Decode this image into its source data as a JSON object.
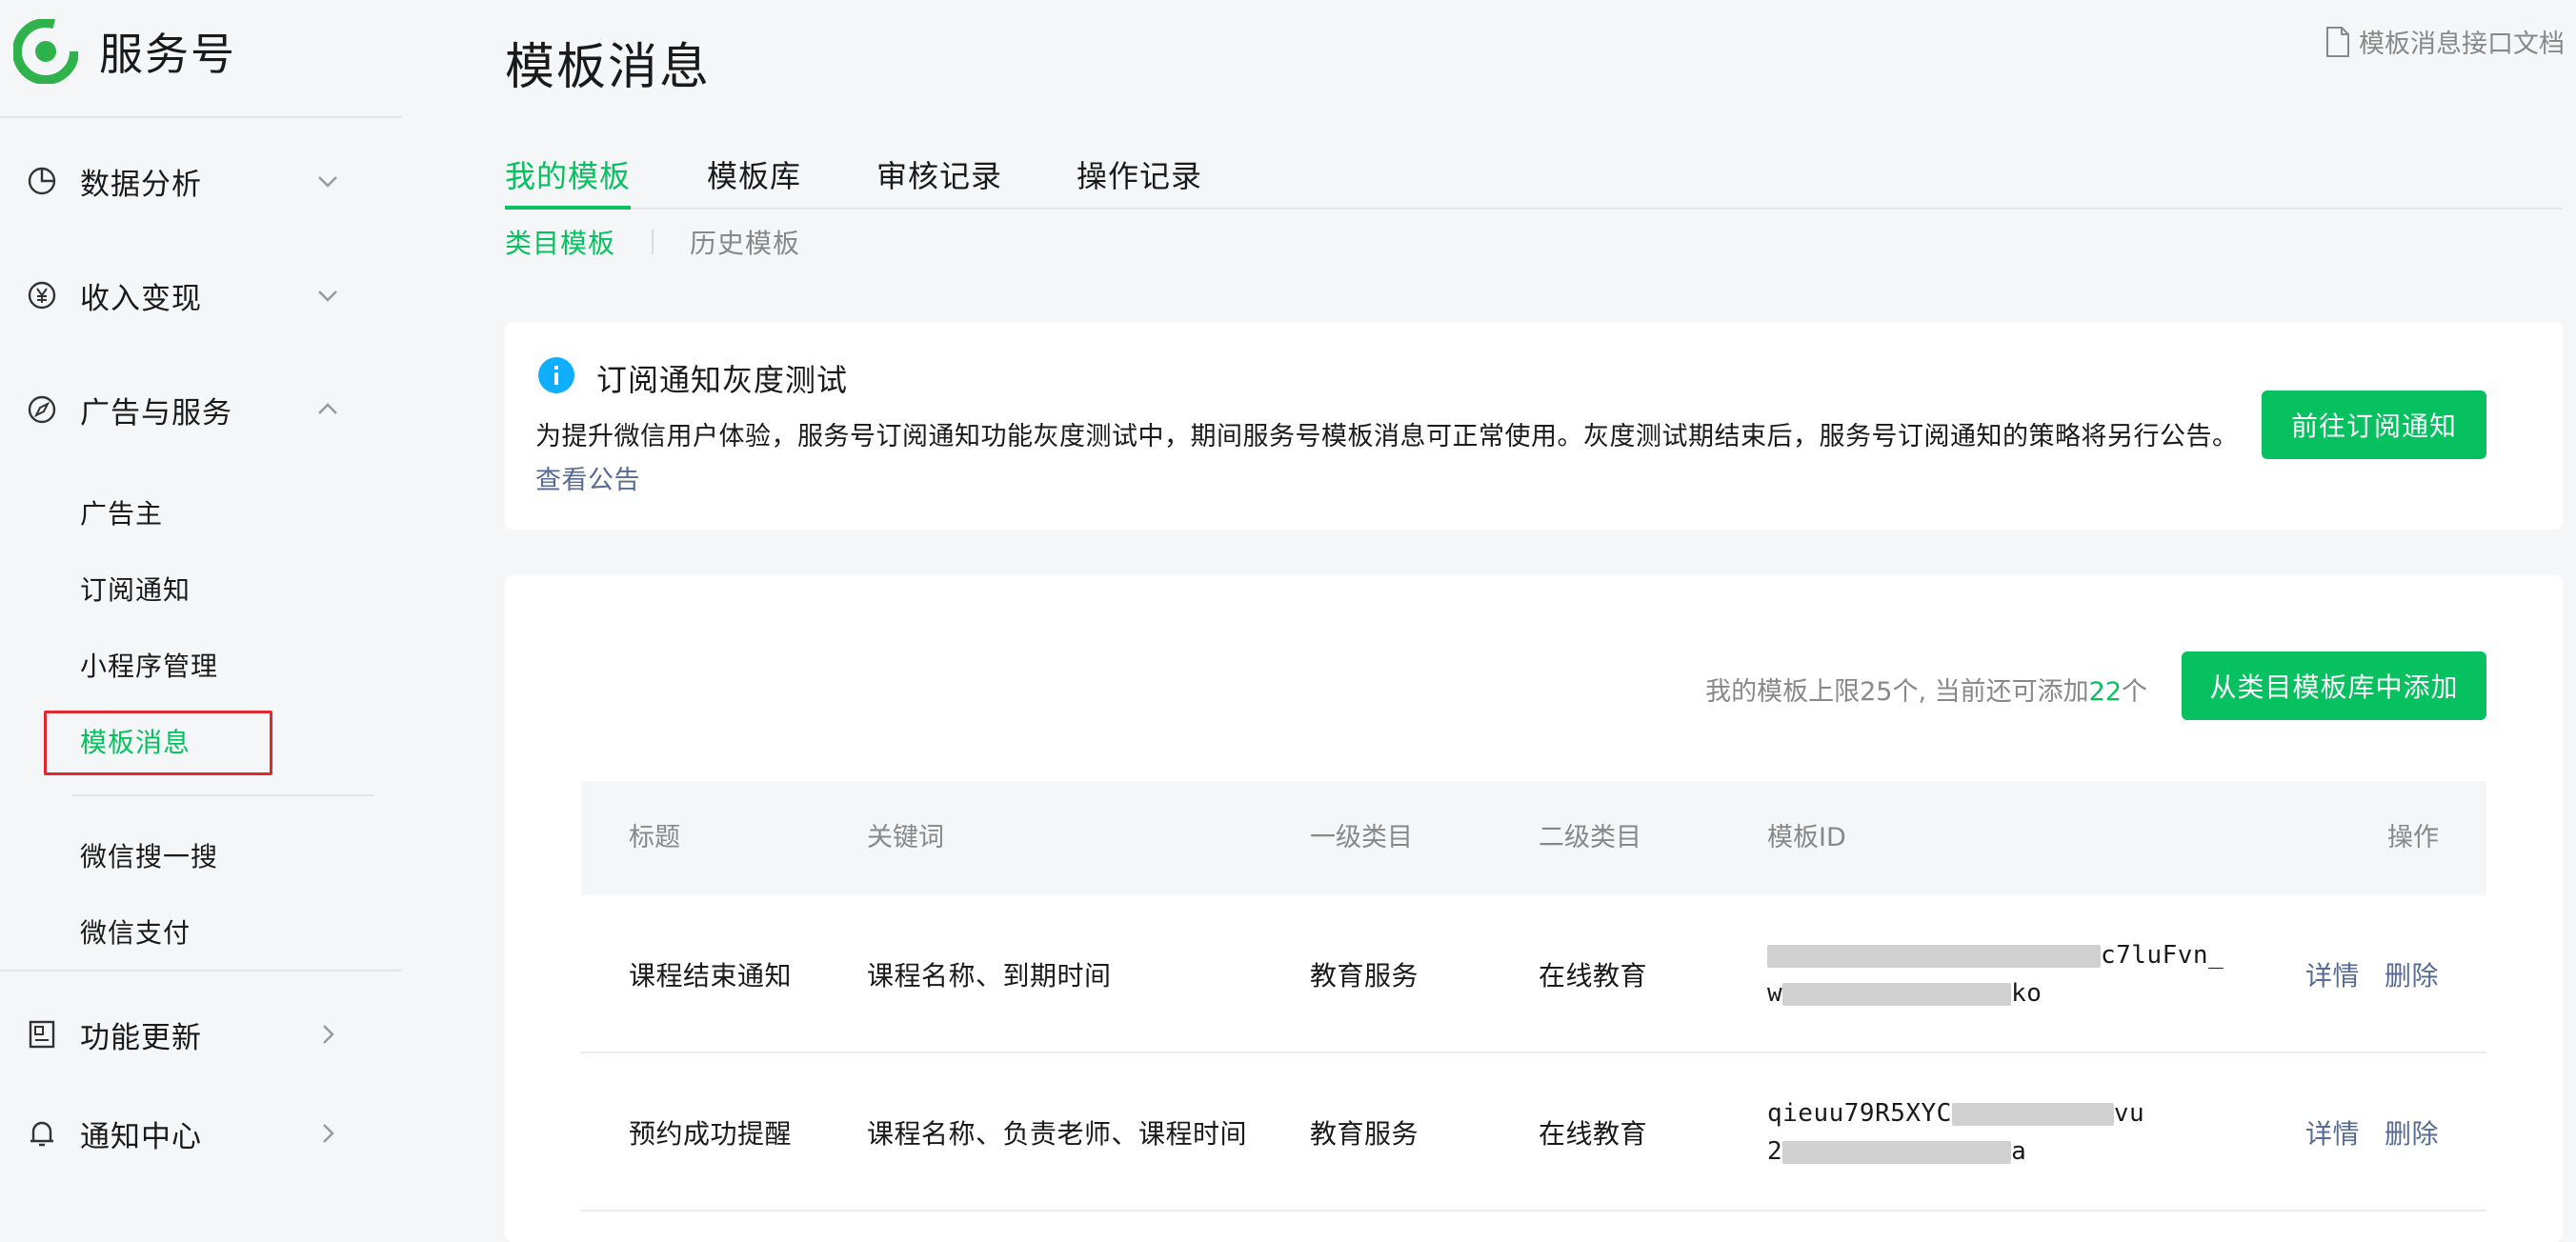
{
  "sidebar": {
    "brand": "服务号",
    "groups": {
      "data": {
        "label": "数据分析"
      },
      "income": {
        "label": "收入变现"
      },
      "ads": {
        "label": "广告与服务"
      },
      "updates": {
        "label": "功能更新"
      },
      "notify": {
        "label": "通知中心"
      }
    },
    "sub_items": {
      "advertiser": "广告主",
      "subscribe": "订阅通知",
      "miniprogram": "小程序管理",
      "template": "模板消息",
      "search": "微信搜一搜",
      "pay": "微信支付"
    }
  },
  "header": {
    "title": "模板消息",
    "doc_link": "模板消息接口文档"
  },
  "tabs": {
    "my": "我的模板",
    "library": "模板库",
    "review": "审核记录",
    "ops": "操作记录"
  },
  "subtabs": {
    "category": "类目模板",
    "history": "历史模板"
  },
  "notice": {
    "title": "订阅通知灰度测试",
    "body": "为提升微信用户体验，服务号订阅通知功能灰度测试中，期间服务号模板消息可正常使用。灰度测试期结束后，服务号订阅通知的策略将另行公告。",
    "link": "查看公告",
    "button": "前往订阅通知"
  },
  "quota": {
    "prefix": "我的模板上限25个, 当前还可添加",
    "remaining": "22",
    "suffix": "个",
    "add_button": "从类目模板库中添加"
  },
  "table": {
    "headers": {
      "title": "标题",
      "keywords": "关键词",
      "cat1": "一级类目",
      "cat2": "二级类目",
      "id": "模板ID",
      "ops": "操作"
    },
    "rows": [
      {
        "title": "课程结束通知",
        "keywords": "课程名称、到期时间",
        "cat1": "教育服务",
        "cat2": "在线教育",
        "id_line1_tail": "c7luFvn_",
        "id_line2_head": "w",
        "id_line2_tail": "ko",
        "detail": "详情",
        "delete": "删除"
      },
      {
        "title": "预约成功提醒",
        "keywords": "课程名称、负责老师、课程时间",
        "cat1": "教育服务",
        "cat2": "在线教育",
        "id_line1_head": "qieuu79R5XYC",
        "id_line1_tail": "vu",
        "id_line2_head": "2",
        "id_line2_tail": "a",
        "detail": "详情",
        "delete": "删除"
      }
    ]
  },
  "colors": {
    "accent": "#07c160",
    "link": "#576b95",
    "highlight_box": "#e0282e"
  }
}
